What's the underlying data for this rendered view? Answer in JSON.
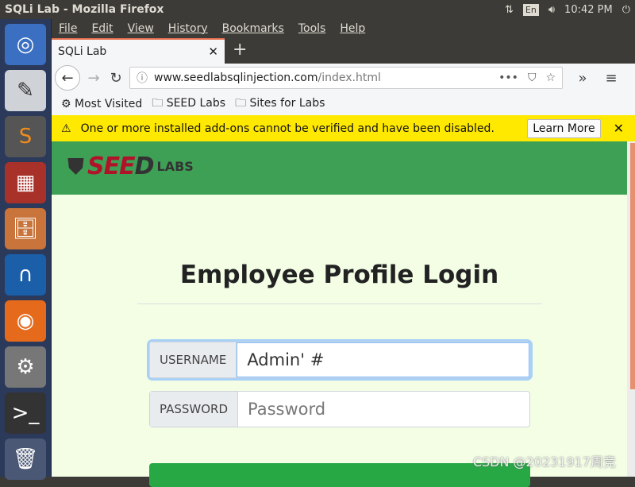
{
  "window_title": "SQLi Lab - Mozilla Firefox",
  "panel": {
    "lang": "En",
    "time": "10:42 PM"
  },
  "launcher": [
    {
      "icon": "ubuntu-icon"
    },
    {
      "icon": "text-editor-icon"
    },
    {
      "icon": "sublime-icon"
    },
    {
      "icon": "terminal-grid-icon"
    },
    {
      "icon": "file-cabinet-icon"
    },
    {
      "icon": "wireshark-icon"
    },
    {
      "icon": "firefox-icon"
    },
    {
      "icon": "settings-icon"
    },
    {
      "icon": "terminal-icon"
    },
    {
      "icon": "trash-icon"
    }
  ],
  "menu": [
    "File",
    "Edit",
    "View",
    "History",
    "Bookmarks",
    "Tools",
    "Help"
  ],
  "tab": {
    "title": "SQLi Lab"
  },
  "url": {
    "domain": "www.seedlabsqlinjection.com",
    "path": "/index.html"
  },
  "bookmarks": [
    "Most Visited",
    "SEED Labs",
    "Sites for Labs"
  ],
  "notification": {
    "text": "One or more installed add-ons cannot be verified and have been disabled.",
    "button": "Learn More"
  },
  "logo": {
    "text": "SEEDLABS"
  },
  "page": {
    "title": "Employee Profile Login",
    "username_label": "USERNAME",
    "username_value": "Admin' #",
    "password_label": "PASSWORD",
    "password_placeholder": "Password"
  },
  "watermark": "CSDN @20231917周竞",
  "colors": {
    "header": "#3ea055",
    "page_bg": "#f3fee5",
    "button": "#28a745",
    "notification": "#ffe900"
  }
}
